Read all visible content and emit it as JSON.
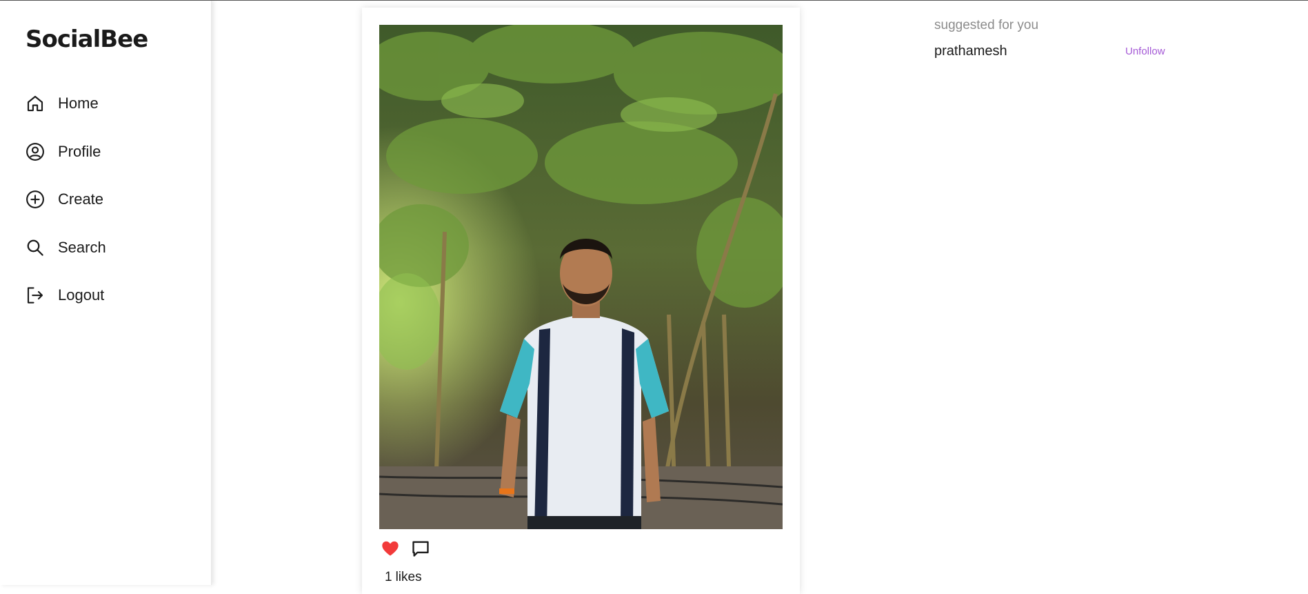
{
  "app": {
    "logo": "SocialBee"
  },
  "sidebar": {
    "items": [
      {
        "label": "Home",
        "icon": "home-icon"
      },
      {
        "label": "Profile",
        "icon": "user-circle-icon"
      },
      {
        "label": "Create",
        "icon": "plus-circle-icon"
      },
      {
        "label": "Search",
        "icon": "search-icon"
      },
      {
        "label": "Logout",
        "icon": "logout-icon"
      }
    ]
  },
  "post": {
    "image": "photo of a man in a white and teal polo standing under bamboo",
    "liked": true,
    "likes_count": "1",
    "likes_suffix": "likes",
    "like_color": "#f23a3a"
  },
  "suggestions": {
    "title": "suggested for you",
    "users": [
      {
        "username": "prathamesh",
        "action_label": "Unfollow",
        "action_color": "#a55ad6"
      }
    ]
  }
}
